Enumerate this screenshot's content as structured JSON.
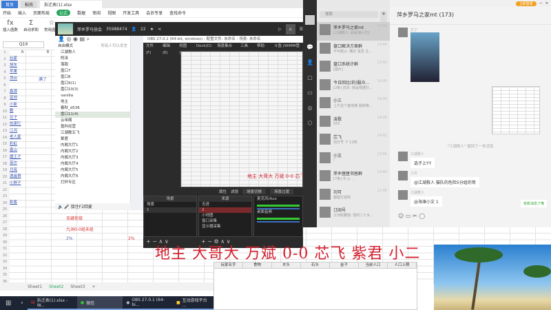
{
  "spreadsheet": {
    "tabs": [
      "首页",
      "稻壳",
      "拆迁表(1).xlsx"
    ],
    "menu": [
      "开始",
      "插入",
      "页面布局",
      "公式",
      "数据",
      "审阅",
      "视图",
      "开发工具",
      "会员专享",
      "查找命令"
    ],
    "active_menu": "公式",
    "toolbar": [
      {
        "icon": "fx",
        "label": "插入函数"
      },
      {
        "icon": "Σ",
        "label": "自动求和"
      },
      {
        "icon": "☆",
        "label": "常用函数"
      }
    ],
    "name_box": "Q19",
    "columns": [
      "A",
      "B"
    ],
    "col_a": [
      "玩家",
      "旭东",
      "苹果",
      "萍州",
      "",
      "鑫源",
      "蓝领",
      "小新",
      "鹏",
      "花子",
      "凯莱叮",
      "江鸿",
      "老人家",
      "彩虹",
      "鑫山",
      "魔王子",
      "菲尔",
      "月亮",
      "逍遥哥",
      "小胖子",
      "",
      "",
      "刺客"
    ],
    "col_b_header": "满了",
    "row_notes": [
      "无缝衔接",
      "九洲0-0组未组"
    ],
    "percents": [
      "2%",
      "2%"
    ],
    "sheets": [
      "Sheet1",
      "Sheet2",
      "Sheet3"
    ],
    "active_sheet": "Sheet2"
  },
  "yy": {
    "channel": "萍乡罗马协会",
    "id": "35988474",
    "users": "22",
    "mode": "自由模式",
    "notice": "所有人可以发言",
    "tree": [
      "江湖救人",
      "阿泽",
      "落跑",
      "盘口7",
      "盘口8",
      "盘口9(1)",
      "盘口10(3)",
      "vanilla",
      "地主",
      "春秋_d536",
      "盘口11(4)",
      "云帝阁",
      "盈科经营",
      "江湖散五飞",
      "紫君",
      "内阁大厅1",
      "内阁大厅2",
      "内阁大厅3",
      "内阁大厅4",
      "内阁大厅5",
      "内阁大厅6",
      "打杯专区"
    ],
    "selected": "盘口11(4)",
    "footer": "接住F2回麦"
  },
  "obs": {
    "title": "OBS 27.0.1 (64-bit, windows) - 配置文件: 未命名 - 场景: 未命名",
    "menu": [
      "文件(F)",
      "编辑(E)",
      "视图(V)",
      "Dock(D)",
      "场景集合(S)",
      "工具(T)",
      "帮助(H)",
      "斗鱼 (WIMM管SDI)"
    ],
    "buttons": [
      "属性",
      "滤镜",
      "场景切换",
      "场景过渡"
    ],
    "scenes_header": "场景",
    "scenes": [
      "场景",
      "1"
    ],
    "sources_header": "来源",
    "sources": [
      "无进",
      "2",
      "小地图",
      "窗口采集",
      "显示器采集"
    ],
    "mixer": [
      "麦克风/Aux",
      "桌面音频"
    ]
  },
  "wechat": {
    "search": "搜索",
    "vip": "立即登录",
    "chats": [
      {
        "name": "萍乡罗马之家mt",
        "preview": "[江湖救人: 赵是滑小文]",
        "time": "13:46"
      },
      {
        "name": "盘口解决方案群",
        "preview": "不可能以: 确定 是否 正...",
        "time": "13:44"
      },
      {
        "name": "盘口系统计群",
        "preview": "[图片]",
        "time": "13:01"
      },
      {
        "name": "今日回比(的)服众...",
        "preview": "[2条] 苏苏: 我是根据打...",
        "time": "14:05"
      },
      {
        "name": "小三",
        "preview": "上午这个盘地满 我和哦...",
        "time": "14:04"
      },
      {
        "name": "凌歌",
        "preview": "555",
        "time": "14:00"
      },
      {
        "name": "芯飞",
        "preview": "划分号 下 11吧",
        "time": "14:02"
      },
      {
        "name": "小文",
        "preview": "!",
        "time": "13:45"
      },
      {
        "name": "萍乡匣匣邻居群",
        "preview": "[7条] 手 ◎ ...",
        "time": "13:40"
      },
      {
        "name": "刘可",
        "preview": "都能打游戏",
        "time": "11:46"
      },
      {
        "name": "订阅号",
        "preview": "江河收藏馆: 暂时二十大...",
        "time": ""
      }
    ],
    "title": "萍乡罗马之家mt (173)",
    "messages": [
      {
        "sender": "文了",
        "text": ""
      },
      {
        "sender": "",
        "text": "\"江湖救人\" 撤回了一条消息"
      },
      {
        "sender": "江湖救人",
        "text": "选子上YY"
      },
      {
        "sender": "小文",
        "text": "@江湖救人 猫队的危险5分组的哥"
      },
      {
        "sender": "江湖救人",
        "text": "@海滩小文 1"
      }
    ],
    "new_msg": "有新消息了哦"
  },
  "overlay": "地主 大哥大 万斌 0-0 芯飞 紫君 小二",
  "table": {
    "headers": [
      "玩家名字",
      "食物",
      "木头",
      "石头",
      "金子",
      "当前人口",
      "人口上限"
    ]
  },
  "taskbar": [
    "拆迁表(1).xlsx - W...",
    "微信",
    "OBS 27.0.1 (64-bi...",
    "互动游戏平台 ..."
  ]
}
